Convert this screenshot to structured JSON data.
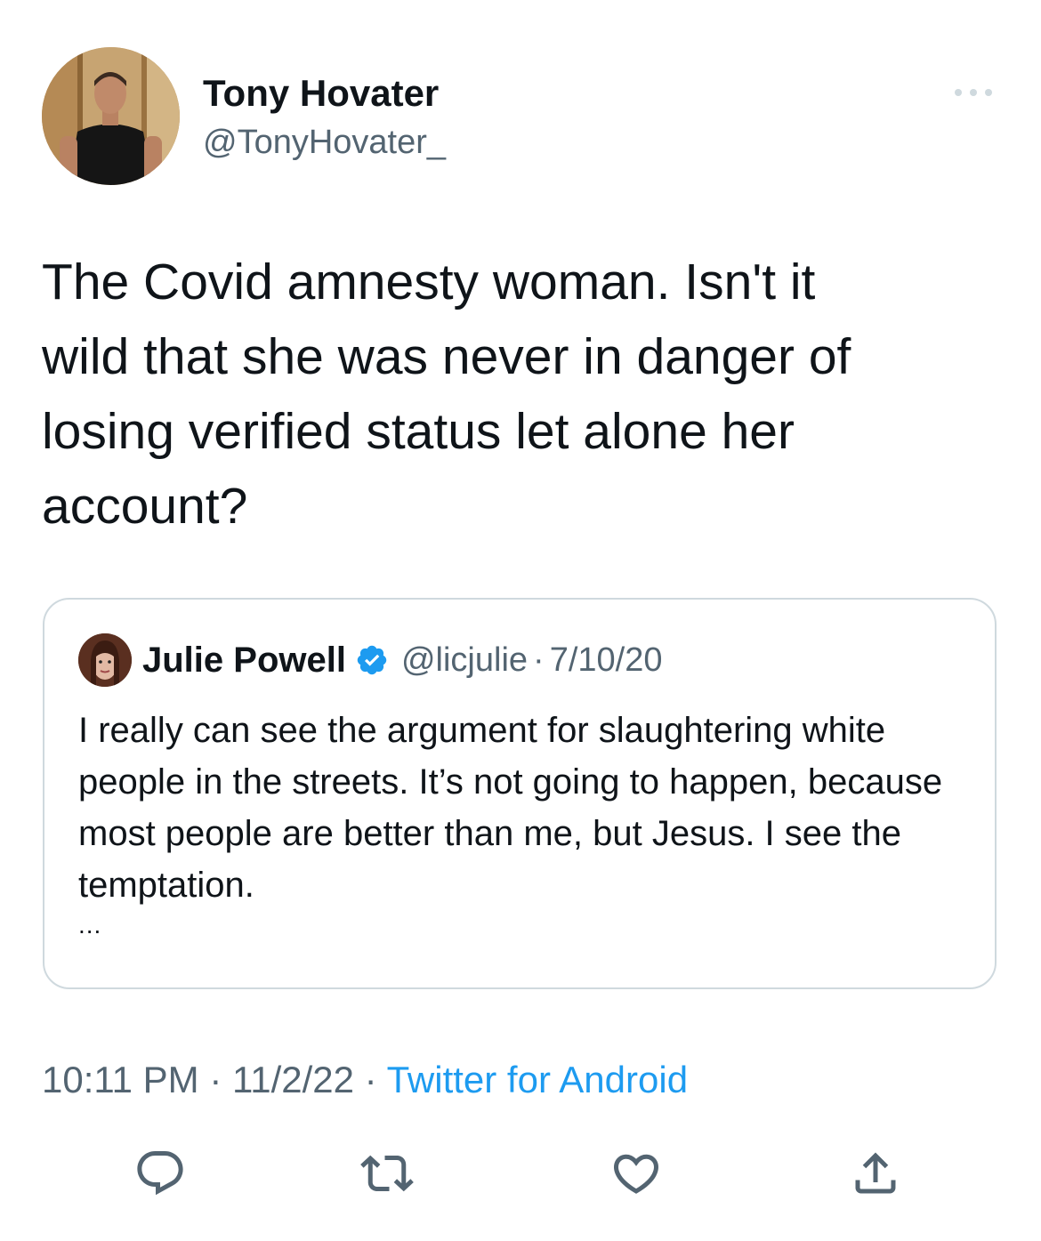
{
  "tweet": {
    "author": {
      "name": "Tony Hovater",
      "handle": "@TonyHovater_",
      "avatar_icon": "profile-photo"
    },
    "more_icon": "more-horizontal-icon",
    "text": "The Covid amnesty woman. Isn't it\nwild that she was never in danger of\nlosing verified status let alone her\naccount?",
    "quote": {
      "name": "Julie Powell",
      "verified_icon": "verified-badge-icon",
      "handle": "@licjulie",
      "separator": "·",
      "date": "7/10/20",
      "text": "I really can see the argument for slaughtering white people in the streets. It’s not going to happen, because most people are better than me, but Jesus. I see the temptation.",
      "ellipsis": "..."
    },
    "time": "10:11 PM",
    "sep1": " · ",
    "date": "11/2/22",
    "sep2": " · ",
    "source": "Twitter for Android",
    "actions": [
      "reply-icon",
      "retweet-icon",
      "like-icon",
      "share-icon"
    ]
  },
  "colors": {
    "text": "#0f1419",
    "secondary": "#536471",
    "accent": "#1d9bf0",
    "border": "#cfd9de"
  }
}
